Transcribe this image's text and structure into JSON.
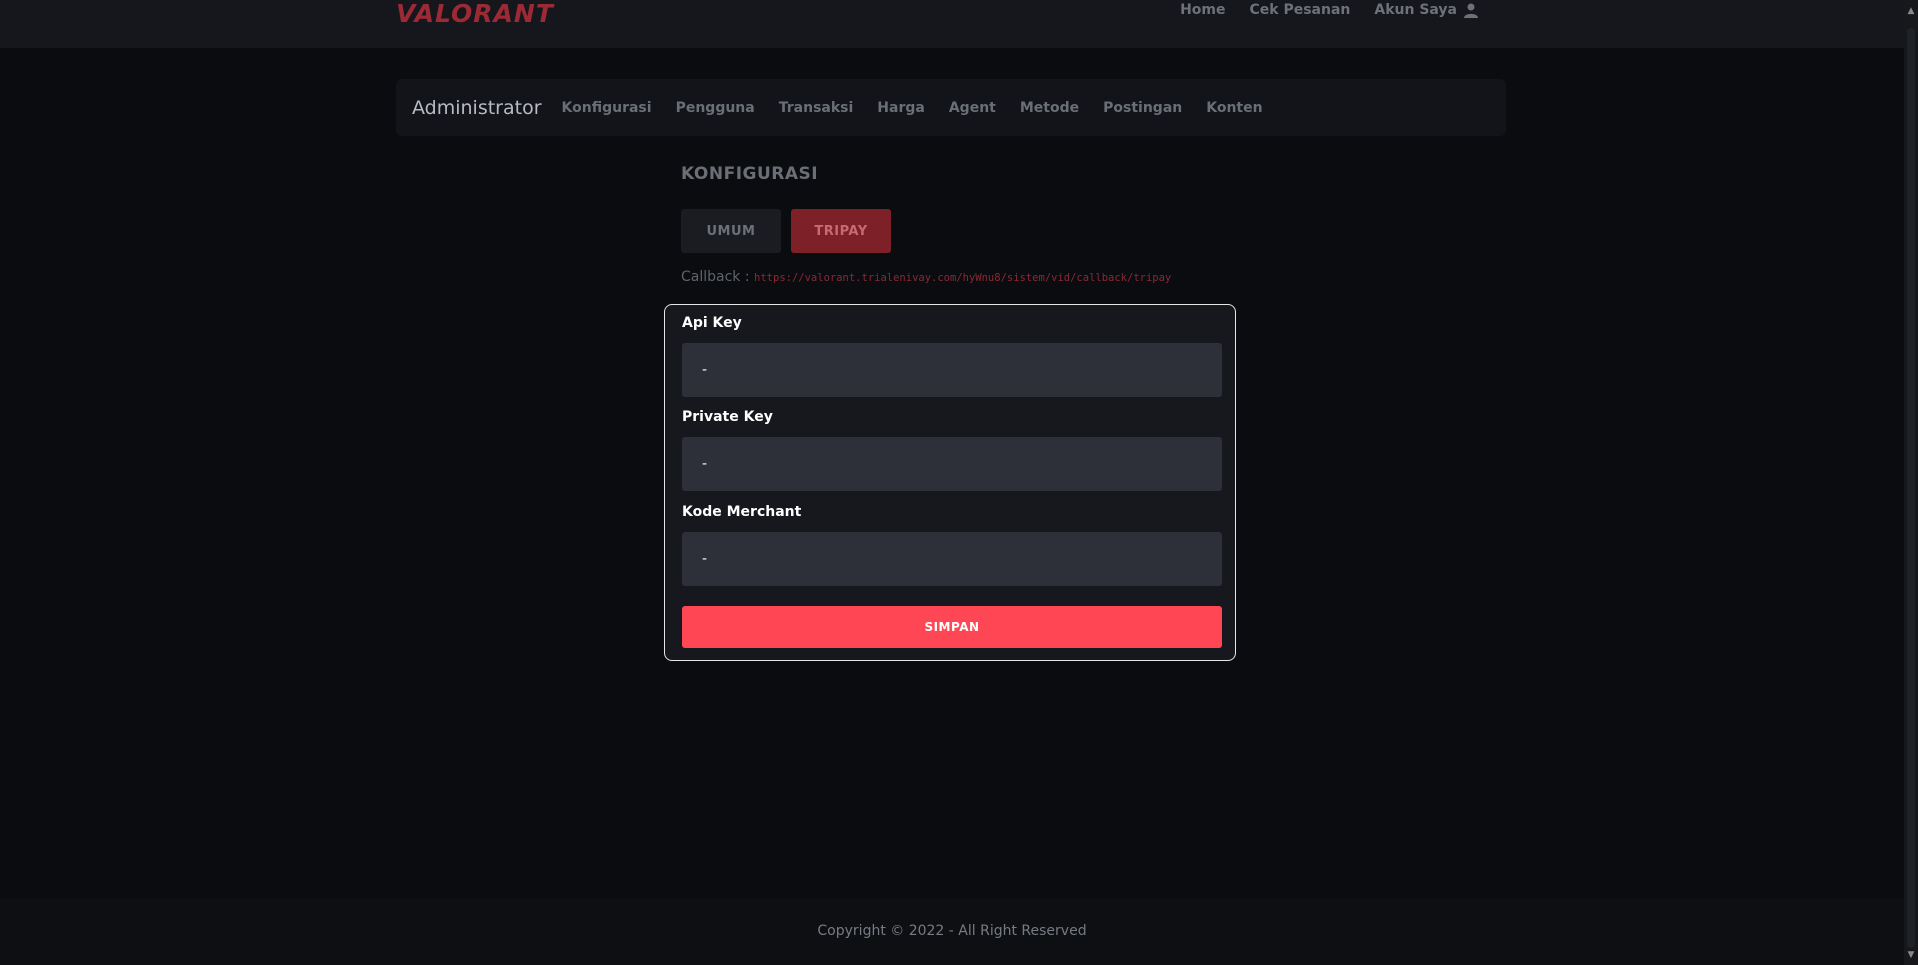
{
  "brand": {
    "logo_text": "VALORANT",
    "accent_color": "#ff4655"
  },
  "top_nav": {
    "items": [
      {
        "label": "Home"
      },
      {
        "label": "Cek Pesanan"
      },
      {
        "label": "Akun Saya",
        "icon": "user-icon"
      }
    ]
  },
  "admin_nav": {
    "brand": "Administrator",
    "links": [
      {
        "label": "Konfigurasi"
      },
      {
        "label": "Pengguna"
      },
      {
        "label": "Transaksi"
      },
      {
        "label": "Harga"
      },
      {
        "label": "Agent"
      },
      {
        "label": "Metode"
      },
      {
        "label": "Postingan"
      },
      {
        "label": "Konten"
      }
    ]
  },
  "section": {
    "title": "KONFIGURASI",
    "tabs": [
      {
        "label": "UMUM",
        "active": false
      },
      {
        "label": "TRIPAY",
        "active": true
      }
    ],
    "callback_label": "Callback :",
    "callback_url": "https://valorant.trialenivay.com/hyWnu8/sistem/vid/callback/tripay"
  },
  "form": {
    "fields": [
      {
        "label": "Api Key",
        "value": "-"
      },
      {
        "label": "Private Key",
        "value": "-"
      },
      {
        "label": "Kode Merchant",
        "value": "-"
      }
    ],
    "submit_label": "SIMPAN"
  },
  "footer": {
    "text": "Copyright © 2022 - All Right Reserved"
  }
}
